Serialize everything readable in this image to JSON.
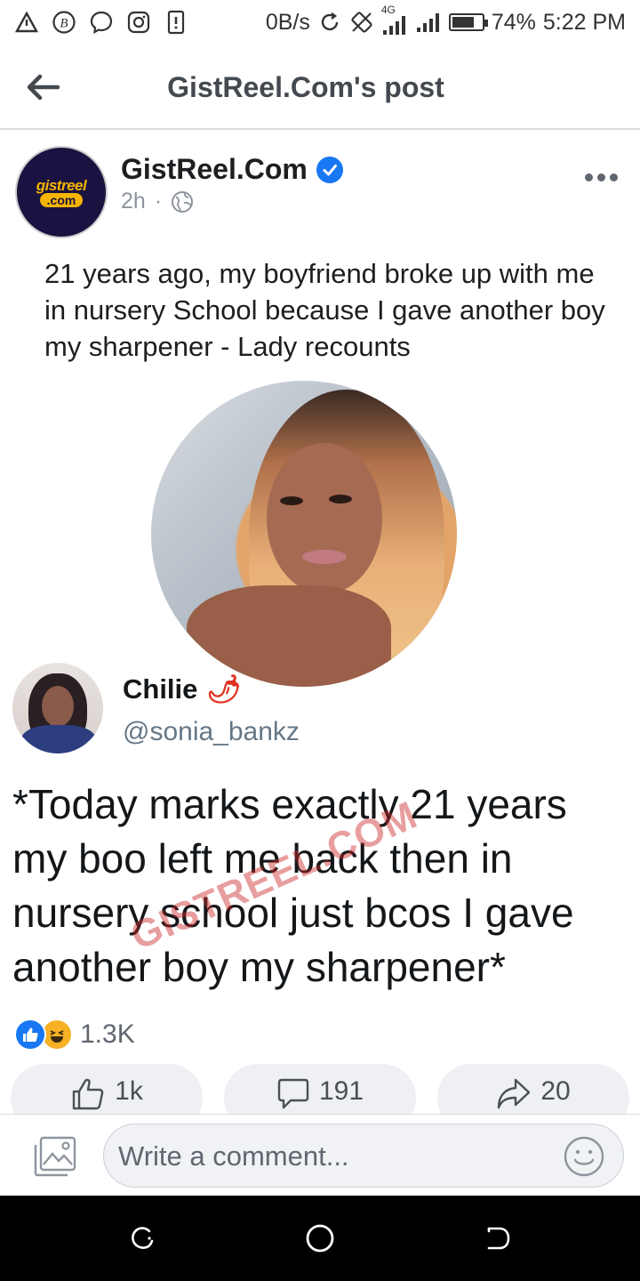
{
  "status_bar": {
    "net_speed": "0B/s",
    "network_type": "4G",
    "battery": "74%",
    "battery_level": 0.74,
    "time": "5:22 PM",
    "icons": [
      "warning-icon",
      "b-app-icon",
      "messenger-icon",
      "instagram-icon",
      "notification-alert-icon",
      "sync-icon",
      "rotation-icon",
      "signal-icon",
      "signal-icon",
      "battery-icon"
    ]
  },
  "header": {
    "title": "GistReel.Com's post",
    "back_icon": "arrow-left-icon"
  },
  "post": {
    "page_name": "GistReel.Com",
    "logo_text_top": "gistreel",
    "logo_text_bottom": ".com",
    "time": "2h",
    "separator": "·",
    "privacy_icon": "globe-icon",
    "text": "21 years ago, my boyfriend broke up with me in nursery School because I gave another boy my sharpener - Lady recounts",
    "image": {
      "tweet_name": "Chilie",
      "tweet_name_emoji": "🌶",
      "tweet_handle": "@sonia_bankz",
      "tweet_text": "*Today marks exactly 21 years my boo left me back then in nursery school just bcos I gave another boy my sharpener*",
      "watermark": "GISTREEL.COM"
    }
  },
  "reactions": {
    "types": [
      "like-reaction-icon",
      "haha-reaction-icon"
    ],
    "count": "1.3K"
  },
  "actions": {
    "like_count": "1k",
    "comment_count": "191",
    "share_count": "20"
  },
  "comment_bar": {
    "placeholder": "Write a comment..."
  },
  "colors": {
    "facebook_blue": "#1877f2",
    "logo_navy": "#1a1240",
    "logo_gold": "#f5b400",
    "watermark_red": "#cc2828"
  }
}
